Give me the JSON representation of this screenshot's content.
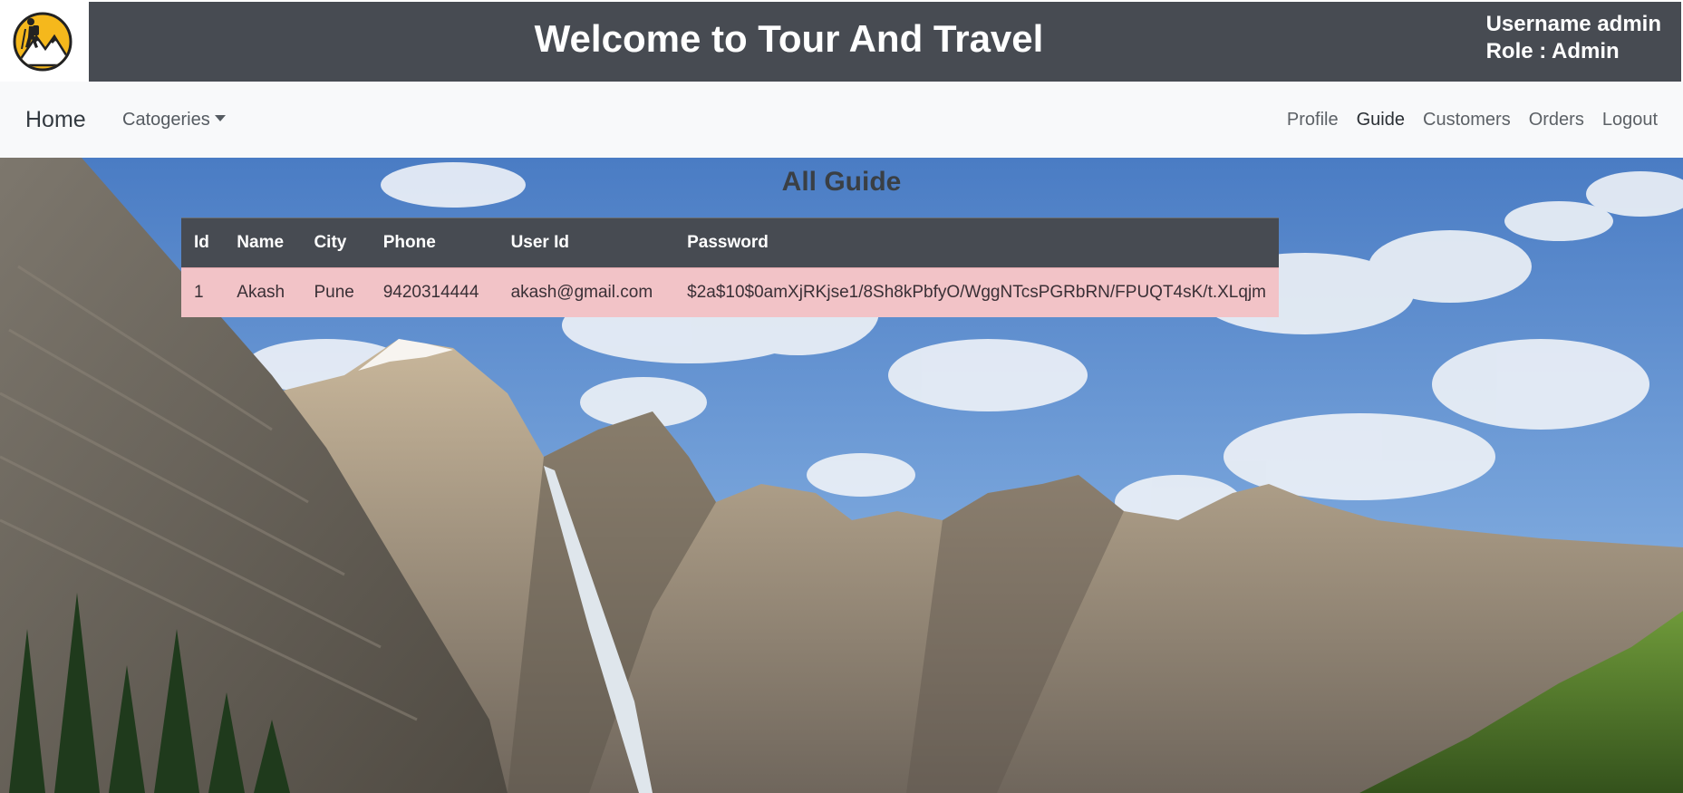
{
  "header": {
    "title": "Welcome to Tour And Travel",
    "username_line": "Username admin",
    "role_line": "Role : Admin"
  },
  "nav": {
    "brand": "Home",
    "dropdown_label": "Catogeries",
    "links": [
      "Profile",
      "Guide",
      "Customers",
      "Orders",
      "Logout"
    ],
    "active": "Guide"
  },
  "page": {
    "title": "All Guide"
  },
  "table": {
    "columns": [
      "Id",
      "Name",
      "City",
      "Phone",
      "User Id",
      "Password"
    ],
    "rows": [
      [
        "1",
        "Akash",
        "Pune",
        "9420314444",
        "akash@gmail.com",
        "$2a$10$0amXjRKjse1/8Sh8kPbfyO/WggNTcsPGRbRN/FPUQT4sK/t.XLqjm"
      ]
    ]
  },
  "colors": {
    "header_bg": "#474b52",
    "navbar_bg": "#f8f9fa",
    "table_head_bg": "#474b52",
    "table_row_bg": "#f2c3c7",
    "logo_accent": "#f5b81c"
  },
  "icons": {
    "logo": "hiker-mountain-logo-icon",
    "dropdown": "caret-down-icon"
  }
}
